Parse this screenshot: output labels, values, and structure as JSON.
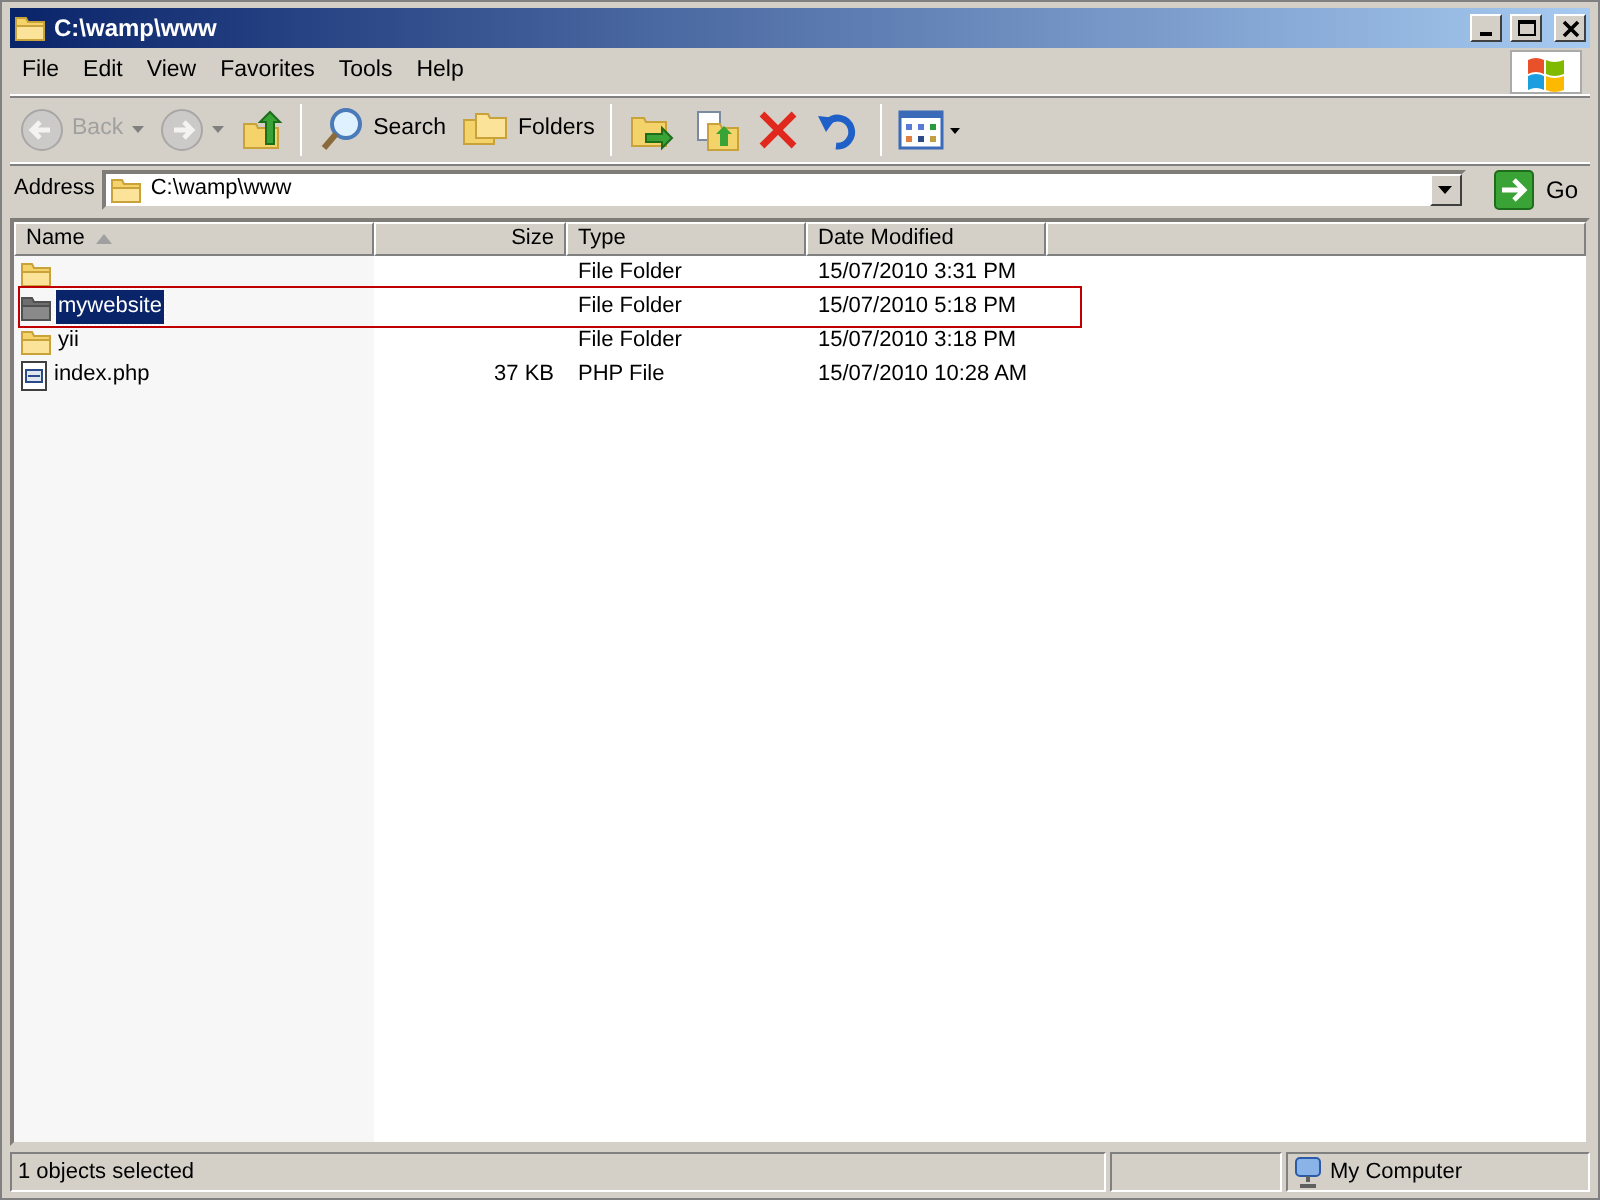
{
  "window": {
    "title": "C:\\wamp\\www"
  },
  "menu": [
    "File",
    "Edit",
    "View",
    "Favorites",
    "Tools",
    "Help"
  ],
  "toolbar": [
    {
      "kind": "back",
      "label": "Back",
      "disabled": true
    },
    {
      "kind": "forward",
      "disabled": true
    },
    {
      "kind": "up"
    },
    {
      "kind": "search",
      "label": "Search"
    },
    {
      "kind": "folders",
      "label": "Folders"
    },
    {
      "kind": "moveto"
    },
    {
      "kind": "copyto"
    },
    {
      "kind": "delete"
    },
    {
      "kind": "undo"
    },
    {
      "kind": "views"
    }
  ],
  "address": {
    "label": "Address",
    "value": "C:\\wamp\\www",
    "go": "Go"
  },
  "table": {
    "columns": [
      {
        "label": "Name",
        "sorted": true
      },
      {
        "label": "Size",
        "sorted": false
      },
      {
        "label": "Type",
        "sorted": false
      },
      {
        "label": "Date Modified",
        "sorted": false
      }
    ],
    "rows": [
      {
        "kind": "folder",
        "type": "File Folder",
        "date": "15/07/2010 3:31 PM",
        "selected": false
      },
      {
        "kind": "folder",
        "name": "mywebsite",
        "type": "File Folder",
        "date": "15/07/2010 5:18 PM",
        "selected": true
      },
      {
        "kind": "folder",
        "name": "yii",
        "type": "File Folder",
        "date": "15/07/2010 3:18 PM",
        "selected": false
      },
      {
        "kind": "file",
        "name": "index.php",
        "size": "37 KB",
        "type": "PHP File",
        "date": "15/07/2010 10:28 AM",
        "selected": false
      }
    ]
  },
  "status_bar": {
    "text": "1 objects selected",
    "location": "My Computer"
  }
}
